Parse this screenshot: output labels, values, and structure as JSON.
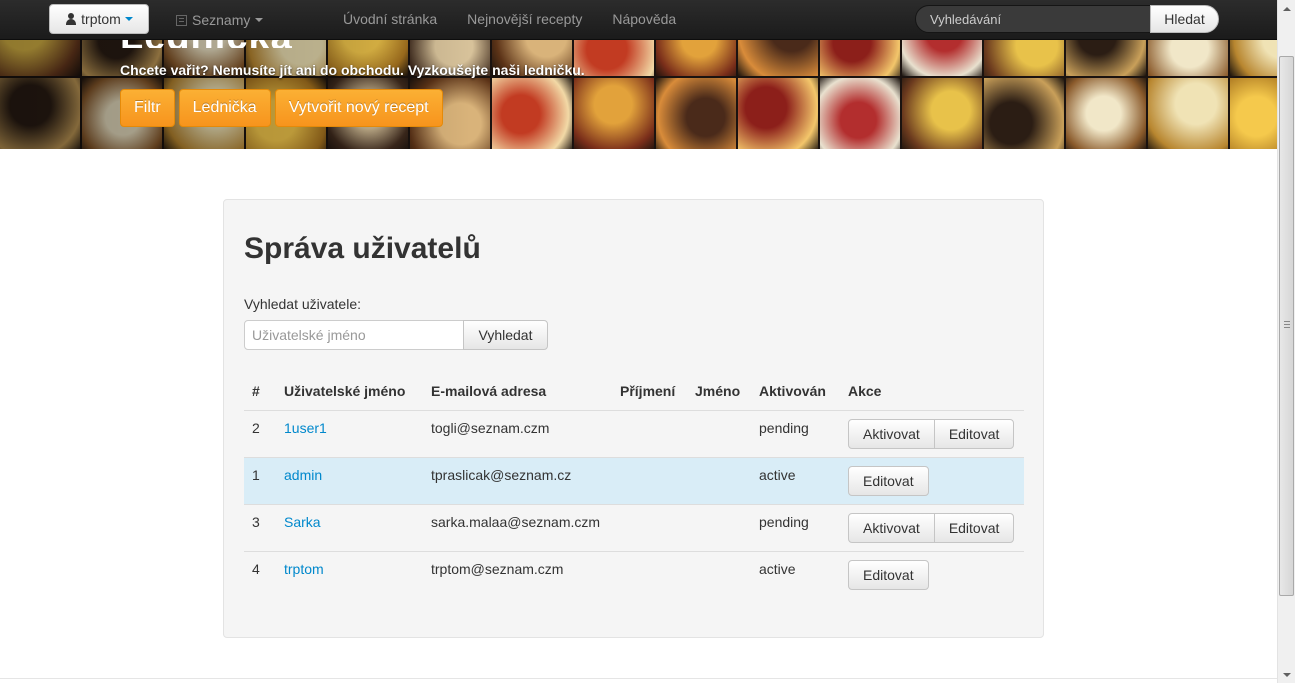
{
  "navbar": {
    "user_label": "trptom",
    "lists_label": "Seznamy",
    "links": [
      "Úvodní stránka",
      "Nejnovější recepty",
      "Nápověda"
    ],
    "search_placeholder": "Vyhledávání",
    "search_button": "Hledat"
  },
  "hero": {
    "tagline": "Chcete vařit? Nemusíte jít ani do obchodu. Vyzkoušejte naši ledničku.",
    "buttons": [
      "Filtr",
      "Lednička",
      "Vytvořit nový recept"
    ]
  },
  "panel": {
    "title": "Správa uživatelů",
    "search_label": "Vyhledat uživatele:",
    "search_placeholder": "Uživatelské jméno",
    "search_button": "Vyhledat"
  },
  "table": {
    "headers": [
      "#",
      "Uživatelské jméno",
      "E-mailová adresa",
      "Příjmení",
      "Jméno",
      "Aktivován",
      "Akce"
    ],
    "rows": [
      {
        "id": "2",
        "username": "1user1",
        "email": "togli@seznam.czm",
        "surname": "",
        "name": "",
        "status": "pending",
        "actions": [
          "Aktivovat",
          "Editovat"
        ]
      },
      {
        "id": "1",
        "username": "admin",
        "email": "tpraslicak@seznam.cz",
        "surname": "",
        "name": "",
        "status": "active",
        "actions": [
          "Editovat"
        ]
      },
      {
        "id": "3",
        "username": "Sarka",
        "email": "sarka.malaa@seznam.czm",
        "surname": "",
        "name": "",
        "status": "pending",
        "actions": [
          "Aktivovat",
          "Editovat"
        ]
      },
      {
        "id": "4",
        "username": "trptom",
        "email": "trptom@seznam.czm",
        "surname": "",
        "name": "",
        "status": "active",
        "actions": [
          "Editovat"
        ]
      }
    ]
  },
  "colors": {
    "accent_orange": "#f7941d",
    "link_blue": "#0088cc",
    "highlight_row": "#d9edf7",
    "navbar_dark": "#1b1b1b"
  },
  "icons": [
    "user-icon",
    "list-icon",
    "chevron-down-icon"
  ]
}
